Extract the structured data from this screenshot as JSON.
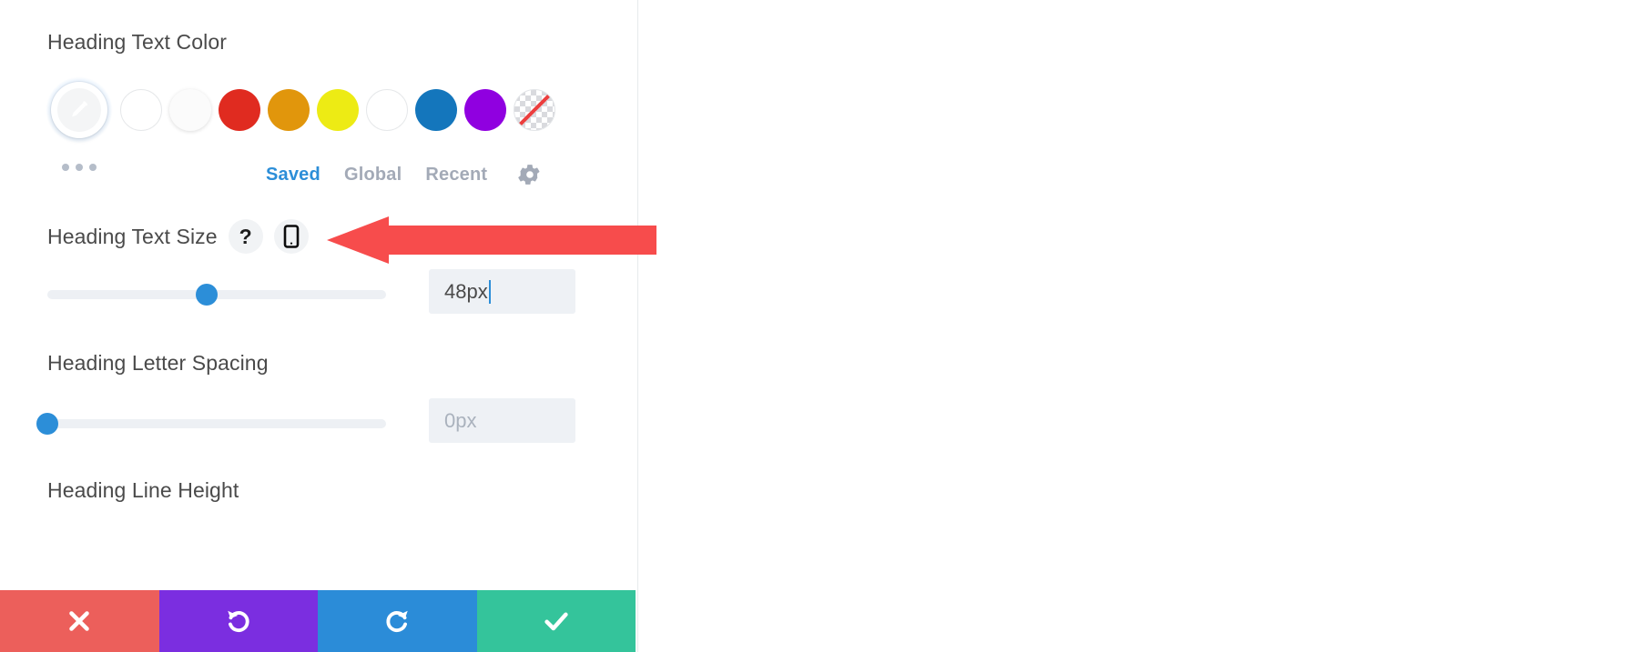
{
  "panel": {
    "color_section": {
      "label": "Heading Text Color",
      "picker": {
        "name": "eyedropper-color-picker",
        "active": true
      },
      "swatches": [
        {
          "name": "swatch-white-outline",
          "color": "#ffffff",
          "style": "outline"
        },
        {
          "name": "swatch-white",
          "color": "#fbfbfb",
          "style": "solid"
        },
        {
          "name": "swatch-red",
          "color": "#e02b20",
          "style": "solid"
        },
        {
          "name": "swatch-orange",
          "color": "#e1960c",
          "style": "solid"
        },
        {
          "name": "swatch-yellow",
          "color": "#edeb14",
          "style": "solid"
        },
        {
          "name": "swatch-white-2",
          "color": "#ffffff",
          "style": "outline"
        },
        {
          "name": "swatch-blue",
          "color": "#1476bc",
          "style": "solid"
        },
        {
          "name": "swatch-purple",
          "color": "#9000e0",
          "style": "solid"
        },
        {
          "name": "swatch-transparent",
          "color": "transparent",
          "style": "transparent"
        }
      ],
      "more_options": "•••",
      "tabs": [
        {
          "label": "Saved",
          "active": true
        },
        {
          "label": "Global",
          "active": false
        },
        {
          "label": "Recent",
          "active": false
        }
      ],
      "settings_icon": "gear-icon"
    },
    "text_size": {
      "label": "Heading Text Size",
      "help_icon": "question-mark-icon",
      "device_icon": "mobile-phone-icon",
      "value": "48px",
      "slider_percent": 47,
      "focused": true
    },
    "letter_spacing": {
      "label": "Heading Letter Spacing",
      "value": "0px",
      "slider_percent": 0,
      "is_placeholder": true
    },
    "line_height": {
      "label": "Heading Line Height"
    },
    "actions": [
      {
        "name": "cancel-button",
        "icon": "close-icon",
        "color": "#ec5f5b"
      },
      {
        "name": "undo-button",
        "icon": "undo-icon",
        "color": "#7b2ee0"
      },
      {
        "name": "redo-button",
        "icon": "redo-icon",
        "color": "#2b8cd8"
      },
      {
        "name": "save-button",
        "icon": "check-icon",
        "color": "#34c49b"
      }
    ]
  },
  "annotation": {
    "arrow": {
      "name": "red-pointer-arrow",
      "color": "#f74c4c",
      "points_to": "mobile-phone-icon"
    }
  },
  "colors": {
    "accent_blue": "#2c8ed8",
    "label_gray": "#4a4a4a",
    "muted_gray": "#a3aab7",
    "track_gray": "#edf0f4",
    "field_bg": "#eef1f5"
  }
}
